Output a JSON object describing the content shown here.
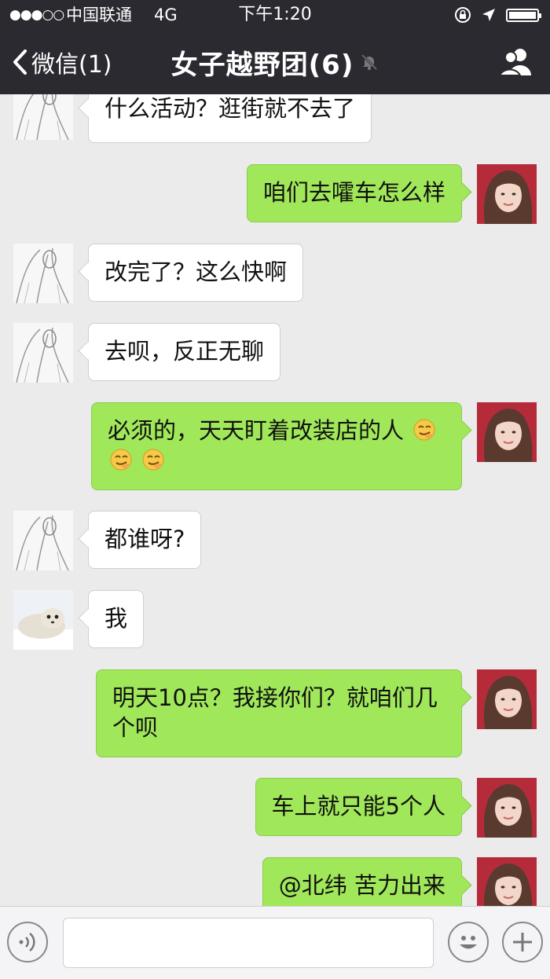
{
  "status_bar": {
    "signal_dots": "●●●○○",
    "carrier": "中国联通",
    "network": "4G",
    "time": "下午1:20"
  },
  "nav": {
    "back_label": "微信(1)",
    "title": "女子越野团(6)"
  },
  "messages": [
    {
      "side": "in",
      "avatar": "sketch-avatar",
      "text": "什么活动？逛街就不去了"
    },
    {
      "side": "out",
      "avatar": "girl-avatar",
      "text": "咱们去嚯车怎么样"
    },
    {
      "side": "in",
      "avatar": "sketch-avatar",
      "text": "改完了？这么快啊"
    },
    {
      "side": "in",
      "avatar": "sketch-avatar",
      "text": "去呗，反正无聊"
    },
    {
      "side": "out",
      "avatar": "girl-avatar",
      "text": "必须的，天天盯着改装店的人",
      "emoji": [
        "smirk-emoji",
        "smirk-emoji",
        "smirk-emoji"
      ]
    },
    {
      "side": "in",
      "avatar": "sketch-avatar",
      "text": "都谁呀?"
    },
    {
      "side": "in",
      "avatar": "seal-avatar",
      "text": "我"
    },
    {
      "side": "out",
      "avatar": "girl-avatar",
      "text": "明天10点？我接你们？就咱们几个呗"
    },
    {
      "side": "out",
      "avatar": "girl-avatar",
      "text": "车上就只能5个人"
    },
    {
      "side": "out",
      "avatar": "girl-avatar",
      "text": "@北纬 苦力出来"
    }
  ],
  "input_bar": {
    "icons": [
      "voice-icon",
      "emoji-icon",
      "plus-icon"
    ],
    "message_value": ""
  },
  "colors": {
    "header": "#2b2a30",
    "chat_bg": "#ebebeb",
    "bubble_out": "#a0e759",
    "bubble_in": "#ffffff"
  }
}
